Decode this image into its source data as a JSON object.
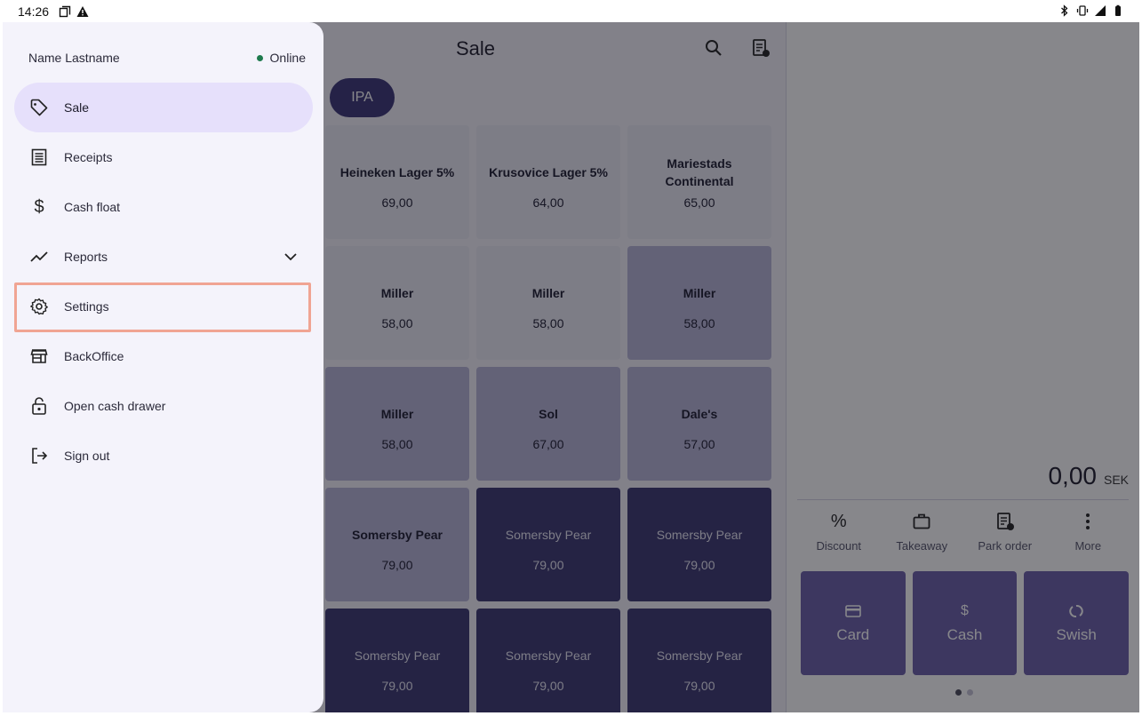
{
  "status_bar": {
    "time": "14:26"
  },
  "sale": {
    "title": "Sale",
    "category_chip": "IPA",
    "products": [
      {
        "name": "Heineken Lager 5%",
        "price": "69,00",
        "tone": "light"
      },
      {
        "name": "Krusovice Lager 5%",
        "price": "64,00",
        "tone": "light"
      },
      {
        "name": "Mariestads Continental",
        "price": "65,00",
        "tone": "light"
      },
      {
        "name": "Miller",
        "price": "58,00",
        "tone": "light"
      },
      {
        "name": "Miller",
        "price": "58,00",
        "tone": "light"
      },
      {
        "name": "Miller",
        "price": "58,00",
        "tone": "mid"
      },
      {
        "name": "Miller",
        "price": "58,00",
        "tone": "mid"
      },
      {
        "name": "Sol",
        "price": "67,00",
        "tone": "mid"
      },
      {
        "name": "Dale's",
        "price": "57,00",
        "tone": "mid"
      },
      {
        "name": "Somersby Pear",
        "price": "79,00",
        "tone": "mid"
      },
      {
        "name": "Somersby Pear",
        "price": "79,00",
        "tone": "dark"
      },
      {
        "name": "Somersby Pear",
        "price": "79,00",
        "tone": "dark"
      },
      {
        "name": "Somersby Pear",
        "price": "79,00",
        "tone": "dark"
      },
      {
        "name": "Somersby Pear",
        "price": "79,00",
        "tone": "dark"
      },
      {
        "name": "Somersby Pear",
        "price": "79,00",
        "tone": "dark"
      }
    ]
  },
  "cart": {
    "total": "0,00",
    "currency": "SEK",
    "actions": [
      {
        "label": "Discount",
        "icon": "percent-icon"
      },
      {
        "label": "Takeaway",
        "icon": "briefcase-icon"
      },
      {
        "label": "Park order",
        "icon": "park-order-icon"
      },
      {
        "label": "More",
        "icon": "more-vert-icon"
      }
    ],
    "payments": [
      {
        "label": "Card",
        "icon": "card-icon"
      },
      {
        "label": "Cash",
        "icon": "dollar-icon"
      },
      {
        "label": "Swish",
        "icon": "swish-icon"
      }
    ]
  },
  "drawer": {
    "user_name": "Name Lastname",
    "status": "Online",
    "status_color": "#1e7a4d",
    "items": [
      {
        "label": "Sale",
        "icon": "tag-icon",
        "active": true
      },
      {
        "label": "Receipts",
        "icon": "receipt-icon"
      },
      {
        "label": "Cash float",
        "icon": "dollar-icon"
      },
      {
        "label": "Reports",
        "icon": "trending-icon",
        "expandable": true
      },
      {
        "label": "Settings",
        "icon": "gear-icon",
        "highlighted": true
      },
      {
        "label": "BackOffice",
        "icon": "store-icon"
      },
      {
        "label": "Open cash drawer",
        "icon": "lock-open-icon"
      },
      {
        "label": "Sign out",
        "icon": "logout-icon"
      }
    ]
  },
  "colors": {
    "accent": "#6a5ea8",
    "chip": "#3b3577",
    "active_nav": "#e6e0fb",
    "highlight_border": "#f0a493"
  }
}
